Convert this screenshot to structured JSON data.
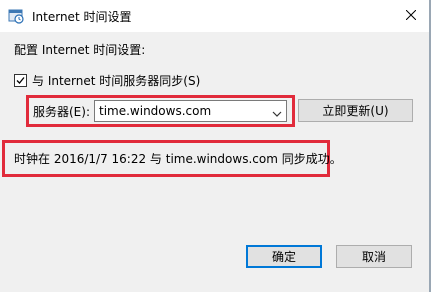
{
  "window": {
    "title": "Internet 时间设置",
    "icon": "clock-settings-icon",
    "close_icon": "close-icon"
  },
  "content": {
    "caption": "配置 Internet 时间设置:",
    "sync_checkbox": {
      "label": "与 Internet 时间服务器同步(S)",
      "checked": true
    },
    "server": {
      "label": "服务器(E):",
      "value": "time.windows.com"
    },
    "update_now_label": "立即更新(U)",
    "status": "时钟在 2016/1/7 16:22 与 time.windows.com 同步成功。"
  },
  "footer": {
    "ok_label": "确定",
    "cancel_label": "取消"
  },
  "colors": {
    "highlight_red": "#e12b3b",
    "accent_blue": "#0078d7",
    "dialog_bg": "#f0f0f0"
  }
}
